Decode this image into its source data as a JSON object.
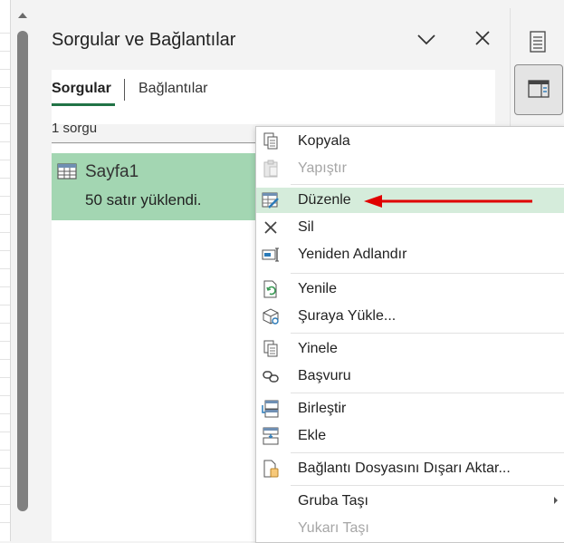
{
  "pane": {
    "title": "Sorgular ve Bağlantılar",
    "tabs": [
      {
        "label": "Sorgular",
        "active": true
      },
      {
        "label": "Bağlantılar",
        "active": false
      }
    ],
    "query_count": "1 sorgu",
    "queries": [
      {
        "name": "Sayfa1",
        "status": "50 satır yüklendi."
      }
    ]
  },
  "context_menu": {
    "items": [
      {
        "label": "Kopyala",
        "icon": "copy-icon",
        "enabled": true
      },
      {
        "label": "Yapıştır",
        "icon": "paste-icon",
        "enabled": false
      },
      {
        "label": "Düzenle",
        "icon": "edit-icon",
        "enabled": true,
        "highlighted": true
      },
      {
        "label": "Sil",
        "icon": "delete-icon",
        "enabled": true
      },
      {
        "label": "Yeniden Adlandır",
        "icon": "rename-icon",
        "enabled": true
      },
      {
        "label": "Yenile",
        "icon": "refresh-icon",
        "enabled": true
      },
      {
        "label": "Şuraya Yükle...",
        "icon": "load-to-icon",
        "enabled": true
      },
      {
        "label": "Yinele",
        "icon": "duplicate-icon",
        "enabled": true
      },
      {
        "label": "Başvuru",
        "icon": "reference-icon",
        "enabled": true
      },
      {
        "label": "Birleştir",
        "icon": "merge-icon",
        "enabled": true
      },
      {
        "label": "Ekle",
        "icon": "append-icon",
        "enabled": true
      },
      {
        "label": "Bağlantı Dosyasını Dışarı Aktar...",
        "icon": "export-connection-icon",
        "enabled": true
      },
      {
        "label": "Gruba Taşı",
        "icon": "",
        "enabled": true,
        "submenu": true
      },
      {
        "label": "Yukarı Taşı",
        "icon": "",
        "enabled": false
      }
    ]
  },
  "colors": {
    "accent_green": "#217346",
    "selected_query_bg": "#a3d6b2",
    "highlight_item_bg": "#d5ecdb",
    "annotation_arrow": "#e00000"
  }
}
